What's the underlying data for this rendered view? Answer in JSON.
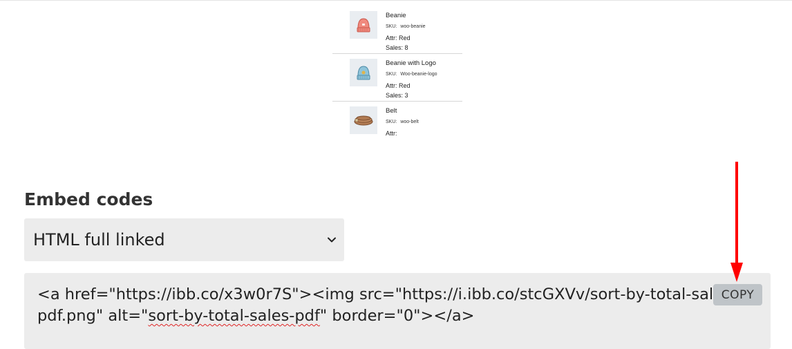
{
  "preview": {
    "products": [
      {
        "name": "Beanie",
        "sku_label": "SKU:",
        "sku": "woo-beanie",
        "attr": "Attr: Red",
        "sales": "Sales: 8",
        "icon": "beanie-icon",
        "color": "#f08a7e"
      },
      {
        "name": "Beanie with Logo",
        "sku_label": "SKU:",
        "sku": "Woo-beanie-logo",
        "attr": "Attr: Red",
        "sales": "Sales: 3",
        "icon": "beanie-logo-icon",
        "color": "#8fc4da"
      },
      {
        "name": "Belt",
        "sku_label": "SKU:",
        "sku": "woo-belt",
        "attr": "Attr:",
        "sales": "",
        "icon": "belt-icon",
        "color": "#b07a52"
      }
    ]
  },
  "embed": {
    "title": "Embed codes",
    "select_value": "HTML full linked",
    "code_line1": "<a href=\"https://ibb.co/x3w0r7S\"><img src=\"https://i.ibb.co/stcGXVv/sort-by-total-sales-",
    "code_line2_pre": "pdf.png\" alt=\"",
    "code_line2_spell": "sort-by-total-sales-pdf",
    "code_line2_post": "\" border=\"0\"></a>",
    "copy_label": "COPY"
  },
  "colors": {
    "arrow": "#ff0000",
    "field_bg": "#ececec",
    "copy_bg": "#bfc4c8"
  }
}
